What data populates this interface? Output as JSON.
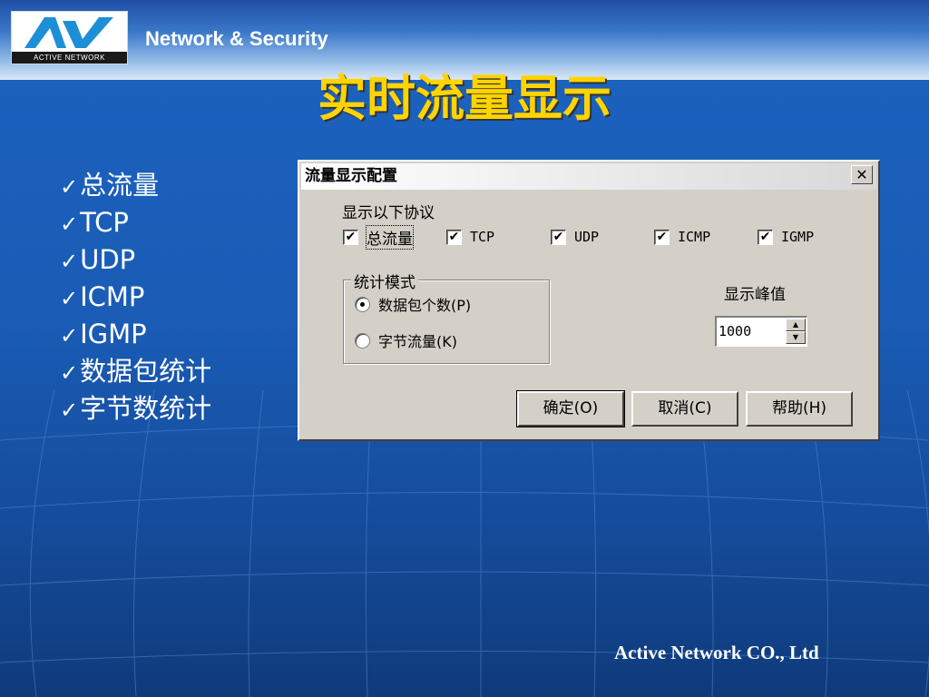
{
  "header": {
    "logo_text": "ACTIVE NETWORK",
    "tagline": "Network & Security"
  },
  "slide": {
    "title": "实时流量显示",
    "bullets": [
      "总流量",
      "TCP",
      "UDP",
      "ICMP",
      "IGMP",
      "数据包统计",
      "字节数统计"
    ],
    "check_glyph": "✓",
    "footer": "Active Network CO., Ltd"
  },
  "dialog": {
    "title": "流量显示配置",
    "close_glyph": "✕",
    "protocols_label": "显示以下协议",
    "protocols": [
      {
        "label": "总流量",
        "checked": true
      },
      {
        "label": "TCP",
        "checked": true
      },
      {
        "label": "UDP",
        "checked": true
      },
      {
        "label": "ICMP",
        "checked": true
      },
      {
        "label": "IGMP",
        "checked": true
      }
    ],
    "check_glyph": "✔",
    "mode_group_label": "统计模式",
    "modes": [
      {
        "label": "数据包个数(P)",
        "selected": true
      },
      {
        "label": "字节流量(K)",
        "selected": false
      }
    ],
    "peak_label": "显示峰值",
    "peak_value": "1000",
    "spin_up": "▲",
    "spin_down": "▼",
    "buttons": {
      "ok": "确定(O)",
      "cancel": "取消(C)",
      "help": "帮助(H)"
    }
  },
  "colors": {
    "title": "#ffd400",
    "background": "#1a5cb6",
    "dialog_face": "#d4d0c8"
  }
}
